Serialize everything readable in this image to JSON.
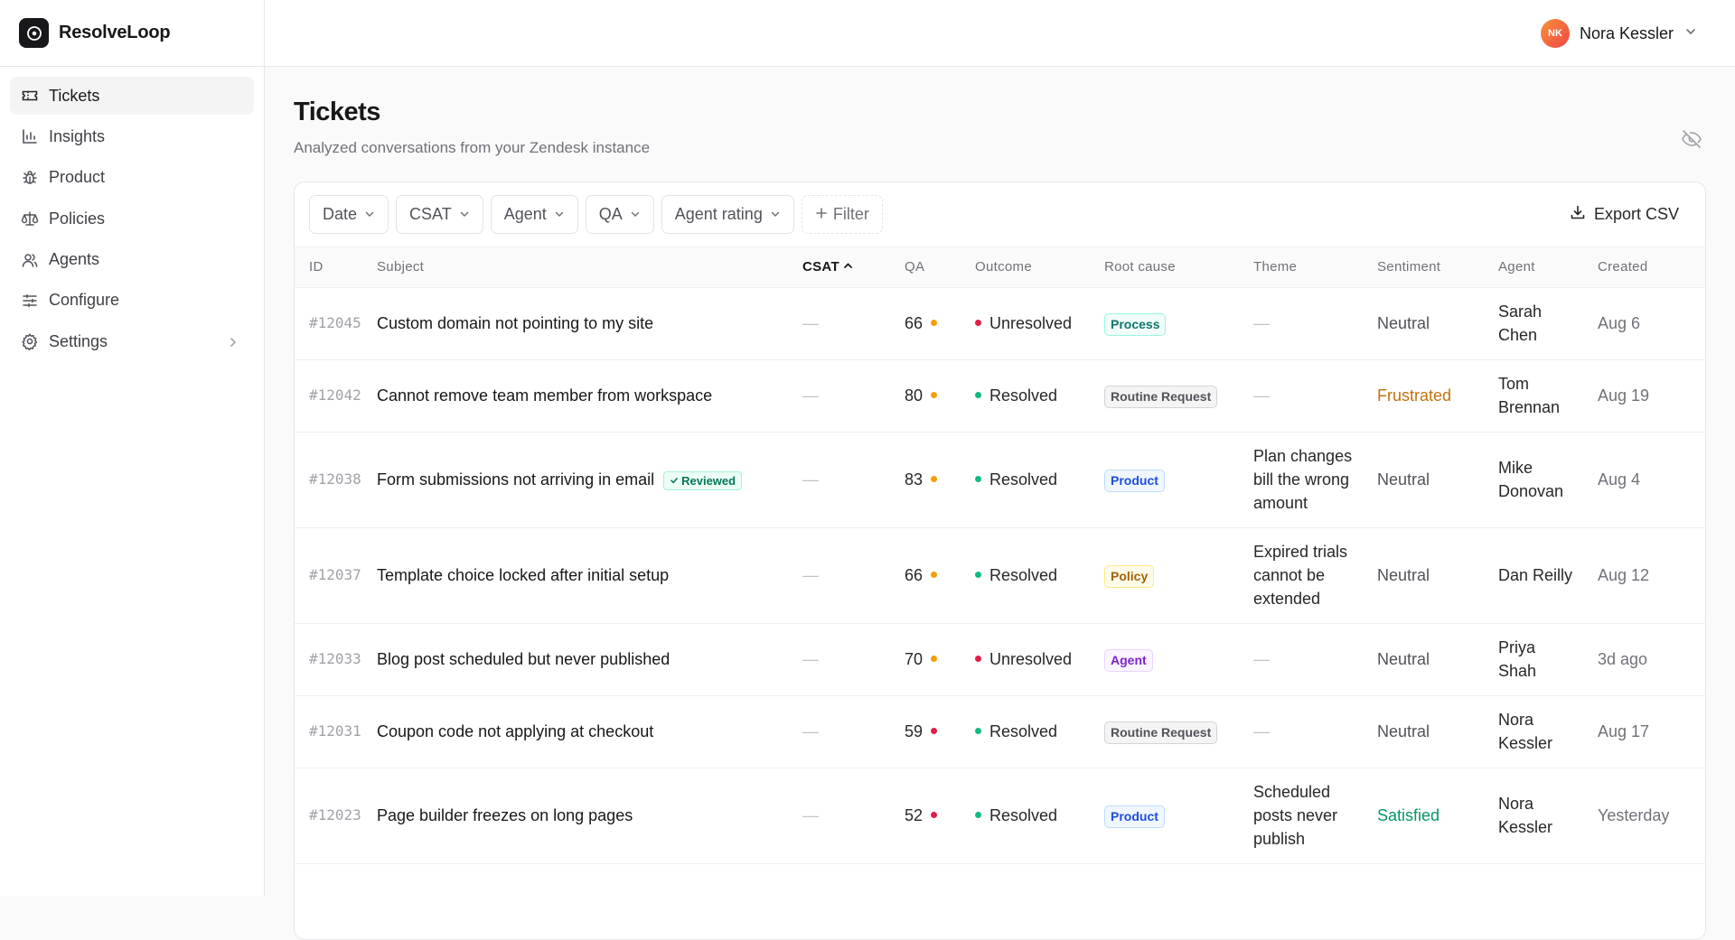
{
  "app": {
    "name": "ResolveLoop"
  },
  "sidebar": {
    "items": [
      {
        "label": "Tickets",
        "icon": "ticket-icon",
        "active": true
      },
      {
        "label": "Insights",
        "icon": "bar-chart-icon"
      },
      {
        "label": "Product",
        "icon": "bug-icon"
      },
      {
        "label": "Policies",
        "icon": "scale-icon"
      },
      {
        "label": "Agents",
        "icon": "users-icon"
      },
      {
        "label": "Configure",
        "icon": "sliders-icon"
      },
      {
        "label": "Settings",
        "icon": "gear-icon",
        "has_submenu": true
      }
    ]
  },
  "user": {
    "initials": "NK",
    "name": "Nora Kessler"
  },
  "page": {
    "title": "Tickets",
    "subtitle": "Analyzed conversations from your Zendesk instance"
  },
  "filters": {
    "buttons": [
      "Date",
      "CSAT",
      "Agent",
      "QA",
      "Agent rating"
    ],
    "add_label": "Filter",
    "export_label": "Export CSV"
  },
  "table": {
    "columns": [
      "ID",
      "Subject",
      "CSAT",
      "QA",
      "Outcome",
      "Root cause",
      "Theme",
      "Sentiment",
      "Agent",
      "Created"
    ],
    "sorted_column": "CSAT",
    "sort_direction": "ascending",
    "rows": [
      {
        "id": "#12045",
        "subject": "Custom domain not pointing to my site",
        "reviewed": "",
        "csat": "—",
        "qa": "66",
        "qa_color": "#f59e0b",
        "outcome": "Unresolved",
        "outcome_color": "#e11d48",
        "root_cause": "Process",
        "root_cause_style": "teal",
        "theme": "—",
        "sentiment": "Neutral",
        "sentiment_color": "#52525b",
        "agent": "Sarah Chen",
        "created": "Aug 6"
      },
      {
        "id": "#12042",
        "subject": "Cannot remove team member from workspace",
        "reviewed": "",
        "csat": "—",
        "qa": "80",
        "qa_color": "#f59e0b",
        "outcome": "Resolved",
        "outcome_color": "#10b981",
        "root_cause": "Routine Request",
        "root_cause_style": "gray",
        "theme": "—",
        "sentiment": "Frustrated",
        "sentiment_color": "#c2710c",
        "agent": "Tom Brennan",
        "created": "Aug 19"
      },
      {
        "id": "#12038",
        "subject": "Form submissions not arriving in email",
        "reviewed": "Reviewed",
        "csat": "—",
        "qa": "83",
        "qa_color": "#f59e0b",
        "outcome": "Resolved",
        "outcome_color": "#10b981",
        "root_cause": "Product",
        "root_cause_style": "blue",
        "theme": "Plan changes bill the wrong amount",
        "sentiment": "Neutral",
        "sentiment_color": "#52525b",
        "agent": "Mike Donovan",
        "created": "Aug 4"
      },
      {
        "id": "#12037",
        "subject": "Template choice locked after initial setup",
        "reviewed": "",
        "csat": "—",
        "qa": "66",
        "qa_color": "#f59e0b",
        "outcome": "Resolved",
        "outcome_color": "#10b981",
        "root_cause": "Policy",
        "root_cause_style": "yellow",
        "theme": "Expired trials cannot be extended",
        "sentiment": "Neutral",
        "sentiment_color": "#52525b",
        "agent": "Dan Reilly",
        "created": "Aug 12"
      },
      {
        "id": "#12033",
        "subject": "Blog post scheduled but never published",
        "reviewed": "",
        "csat": "—",
        "qa": "70",
        "qa_color": "#f59e0b",
        "outcome": "Unresolved",
        "outcome_color": "#e11d48",
        "root_cause": "Agent",
        "root_cause_style": "purple",
        "theme": "—",
        "sentiment": "Neutral",
        "sentiment_color": "#52525b",
        "agent": "Priya Shah",
        "created": "3d ago"
      },
      {
        "id": "#12031",
        "subject": "Coupon code not applying at checkout",
        "reviewed": "",
        "csat": "—",
        "qa": "59",
        "qa_color": "#e11d48",
        "outcome": "Resolved",
        "outcome_color": "#10b981",
        "root_cause": "Routine Request",
        "root_cause_style": "gray",
        "theme": "—",
        "sentiment": "Neutral",
        "sentiment_color": "#52525b",
        "agent": "Nora Kessler",
        "created": "Aug 17"
      },
      {
        "id": "#12023",
        "subject": "Page builder freezes on long pages",
        "reviewed": "",
        "csat": "—",
        "qa": "52",
        "qa_color": "#e11d48",
        "outcome": "Resolved",
        "outcome_color": "#10b981",
        "root_cause": "Product",
        "root_cause_style": "blue",
        "theme": "Scheduled posts never publish",
        "sentiment": "Satisfied",
        "sentiment_color": "#059669",
        "agent": "Nora Kessler",
        "created": "Yesterday"
      }
    ]
  },
  "badge_styles": {
    "teal": {
      "bg": "#f0fdfa",
      "border": "#99f6e4",
      "fg": "#0f766e"
    },
    "gray": {
      "bg": "#f4f4f5",
      "border": "#d4d4d8",
      "fg": "#52525b"
    },
    "blue": {
      "bg": "#eff6ff",
      "border": "#bfdbfe",
      "fg": "#1d4ed8"
    },
    "yellow": {
      "bg": "#fefce8",
      "border": "#fde68a",
      "fg": "#a16207"
    },
    "purple": {
      "bg": "#faf5ff",
      "border": "#e9d5ff",
      "fg": "#7e22ce"
    }
  }
}
